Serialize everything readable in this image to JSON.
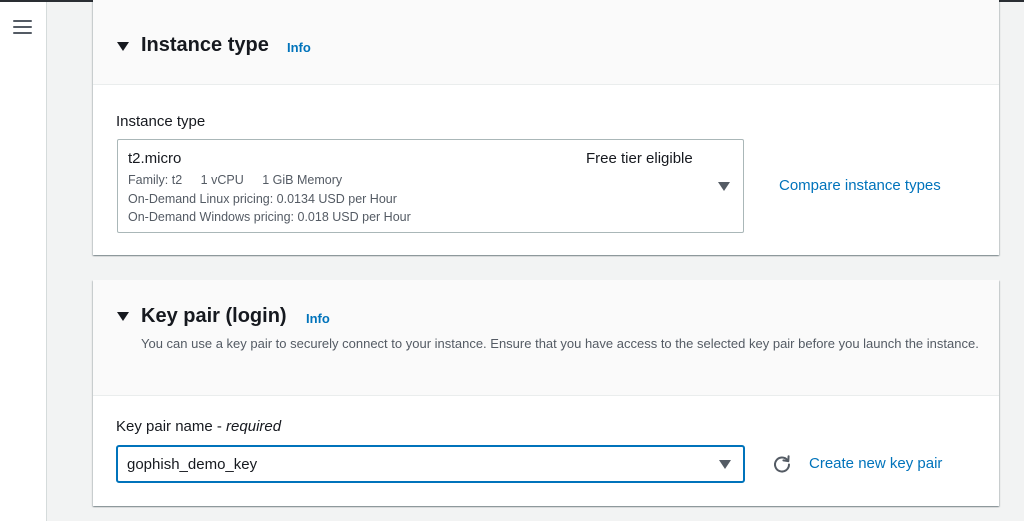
{
  "nav": {
    "menu_icon": "hamburger-menu-icon"
  },
  "instance_type": {
    "title": "Instance type",
    "info": "Info",
    "field_label": "Instance type",
    "selected": {
      "name": "t2.micro",
      "badge": "Free tier eligible",
      "family": "Family: t2",
      "vcpu": "1 vCPU",
      "memory": "1 GiB Memory",
      "linux_pricing": "On-Demand Linux pricing: 0.0134 USD per Hour",
      "windows_pricing": "On-Demand Windows pricing: 0.018 USD per Hour"
    },
    "compare_link": "Compare instance types"
  },
  "key_pair": {
    "title": "Key pair (login)",
    "info": "Info",
    "description": "You can use a key pair to securely connect to your instance. Ensure that you have access to the selected key pair before you launch the instance.",
    "field_label": "Key pair name - ",
    "field_required": "required",
    "selected": "gophish_demo_key",
    "refresh_icon": "refresh-icon",
    "create_link": "Create new key pair"
  },
  "colors": {
    "link": "#0073bb",
    "text": "#16191f",
    "secondary_text": "#545b64",
    "focus_border": "#0073bb",
    "background": "#f2f3f3"
  }
}
